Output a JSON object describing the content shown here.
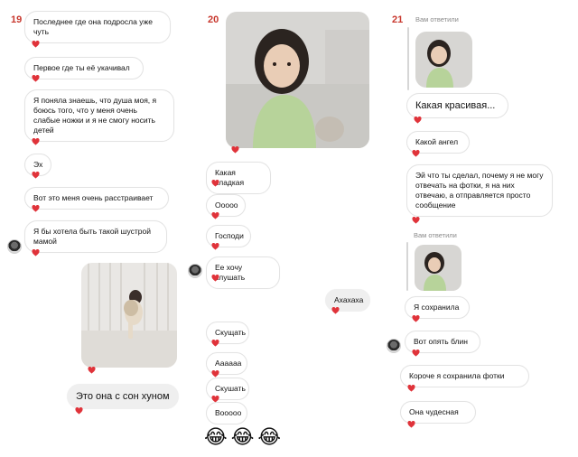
{
  "numbers": [
    "19",
    "20",
    "21"
  ],
  "col1": {
    "messages": [
      "Последнее где она подросла уже чуть",
      "Первое где ты её укачивал",
      "Я поняла знаешь, что душа моя, я боюсь того, что у меня очень слабые ножки и я не смогу носить детей",
      "Эх",
      "Вот это меня очень расстраивает",
      "Я бы хотела быть такой шустрой мамой"
    ],
    "caption": "Это она с сон хуном"
  },
  "col2": {
    "messages": [
      "Какая сладкая",
      "Ооооо",
      "Господи",
      "Ее хочу слушать"
    ],
    "right_message": "Ахахаха",
    "messages2": [
      "Скущать",
      "Аааааа",
      "Скушать",
      "Вооооо"
    ],
    "emojis": "😂😂😂"
  },
  "col3": {
    "reply_label_1": "Вам ответили",
    "big_message": "Какая красивая...",
    "messages": [
      "Какой ангел",
      "Эй что ты сделал, почему я не могу отвечать на фотки, я на них отвечаю, а отправляется просто сообщение"
    ],
    "reply_label_2": "Вам ответили",
    "messages2": [
      "Я сохранила",
      "Вот опять блин",
      "Короче я сохранила фотки",
      "Она чудесная"
    ]
  },
  "colors": {
    "heart": "#e0333a",
    "number": "#c8382e",
    "bubble_border": "#e3e3e3"
  }
}
